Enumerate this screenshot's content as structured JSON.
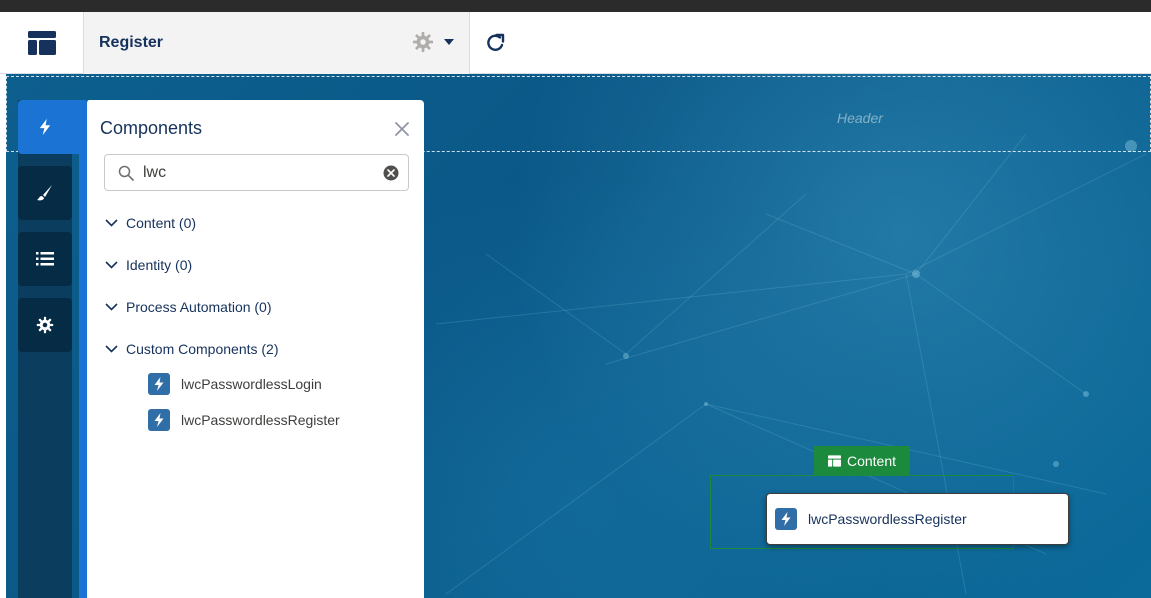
{
  "toolbar": {
    "page_title": "Register"
  },
  "canvas": {
    "header_label": "Header",
    "content_label": "Content",
    "placed_component": "lwcPasswordlessRegister"
  },
  "components_panel": {
    "title": "Components",
    "search": {
      "value": "lwc"
    },
    "categories": [
      {
        "label": "Content (0)"
      },
      {
        "label": "Identity (0)"
      },
      {
        "label": "Process Automation (0)"
      },
      {
        "label": "Custom Components (2)"
      }
    ],
    "custom_components": [
      {
        "label": "lwcPasswordlessLogin"
      },
      {
        "label": "lwcPasswordlessRegister"
      }
    ]
  },
  "colors": {
    "accent": "#1b74d4",
    "text_primary": "#16325c",
    "canvas_bg": "#0a5887",
    "content_green": "#1c8a3c",
    "lwc_icon_bg": "#2f6ea6"
  },
  "icons": {
    "layout": "layout-icon",
    "gear": "gear-icon",
    "caret": "caret-down-icon",
    "refresh": "refresh-icon",
    "components": "lightning-icon",
    "theme": "brush-icon",
    "navigation": "list-icon",
    "settings": "gear-icon",
    "close": "close-icon",
    "search": "search-icon",
    "clear": "clear-icon",
    "chevron": "chevron-down-icon",
    "component_item": "lightning-icon"
  }
}
